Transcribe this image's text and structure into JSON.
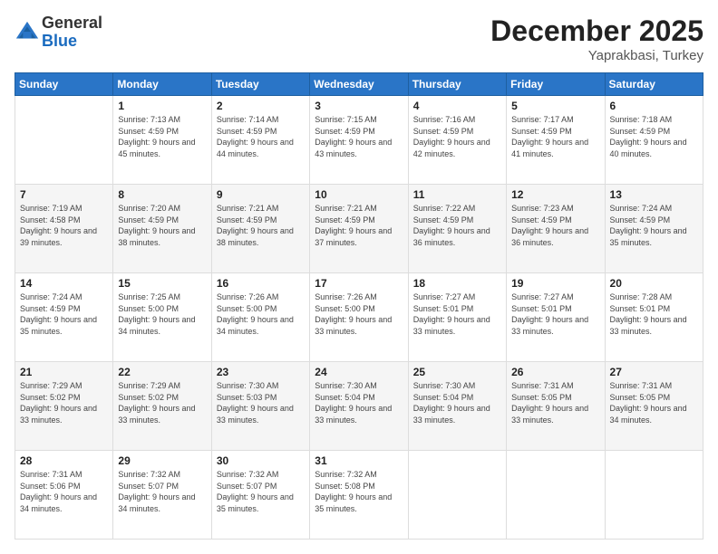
{
  "logo": {
    "general": "General",
    "blue": "Blue"
  },
  "header": {
    "month": "December 2025",
    "location": "Yaprakbasi, Turkey"
  },
  "weekdays": [
    "Sunday",
    "Monday",
    "Tuesday",
    "Wednesday",
    "Thursday",
    "Friday",
    "Saturday"
  ],
  "weeks": [
    [
      {
        "day": "",
        "sunrise": "",
        "sunset": "",
        "daylight": ""
      },
      {
        "day": "1",
        "sunrise": "7:13 AM",
        "sunset": "4:59 PM",
        "daylight": "9 hours and 45 minutes."
      },
      {
        "day": "2",
        "sunrise": "7:14 AM",
        "sunset": "4:59 PM",
        "daylight": "9 hours and 44 minutes."
      },
      {
        "day": "3",
        "sunrise": "7:15 AM",
        "sunset": "4:59 PM",
        "daylight": "9 hours and 43 minutes."
      },
      {
        "day": "4",
        "sunrise": "7:16 AM",
        "sunset": "4:59 PM",
        "daylight": "9 hours and 42 minutes."
      },
      {
        "day": "5",
        "sunrise": "7:17 AM",
        "sunset": "4:59 PM",
        "daylight": "9 hours and 41 minutes."
      },
      {
        "day": "6",
        "sunrise": "7:18 AM",
        "sunset": "4:59 PM",
        "daylight": "9 hours and 40 minutes."
      }
    ],
    [
      {
        "day": "7",
        "sunrise": "7:19 AM",
        "sunset": "4:58 PM",
        "daylight": "9 hours and 39 minutes."
      },
      {
        "day": "8",
        "sunrise": "7:20 AM",
        "sunset": "4:59 PM",
        "daylight": "9 hours and 38 minutes."
      },
      {
        "day": "9",
        "sunrise": "7:21 AM",
        "sunset": "4:59 PM",
        "daylight": "9 hours and 38 minutes."
      },
      {
        "day": "10",
        "sunrise": "7:21 AM",
        "sunset": "4:59 PM",
        "daylight": "9 hours and 37 minutes."
      },
      {
        "day": "11",
        "sunrise": "7:22 AM",
        "sunset": "4:59 PM",
        "daylight": "9 hours and 36 minutes."
      },
      {
        "day": "12",
        "sunrise": "7:23 AM",
        "sunset": "4:59 PM",
        "daylight": "9 hours and 36 minutes."
      },
      {
        "day": "13",
        "sunrise": "7:24 AM",
        "sunset": "4:59 PM",
        "daylight": "9 hours and 35 minutes."
      }
    ],
    [
      {
        "day": "14",
        "sunrise": "7:24 AM",
        "sunset": "4:59 PM",
        "daylight": "9 hours and 35 minutes."
      },
      {
        "day": "15",
        "sunrise": "7:25 AM",
        "sunset": "5:00 PM",
        "daylight": "9 hours and 34 minutes."
      },
      {
        "day": "16",
        "sunrise": "7:26 AM",
        "sunset": "5:00 PM",
        "daylight": "9 hours and 34 minutes."
      },
      {
        "day": "17",
        "sunrise": "7:26 AM",
        "sunset": "5:00 PM",
        "daylight": "9 hours and 33 minutes."
      },
      {
        "day": "18",
        "sunrise": "7:27 AM",
        "sunset": "5:01 PM",
        "daylight": "9 hours and 33 minutes."
      },
      {
        "day": "19",
        "sunrise": "7:27 AM",
        "sunset": "5:01 PM",
        "daylight": "9 hours and 33 minutes."
      },
      {
        "day": "20",
        "sunrise": "7:28 AM",
        "sunset": "5:01 PM",
        "daylight": "9 hours and 33 minutes."
      }
    ],
    [
      {
        "day": "21",
        "sunrise": "7:29 AM",
        "sunset": "5:02 PM",
        "daylight": "9 hours and 33 minutes."
      },
      {
        "day": "22",
        "sunrise": "7:29 AM",
        "sunset": "5:02 PM",
        "daylight": "9 hours and 33 minutes."
      },
      {
        "day": "23",
        "sunrise": "7:30 AM",
        "sunset": "5:03 PM",
        "daylight": "9 hours and 33 minutes."
      },
      {
        "day": "24",
        "sunrise": "7:30 AM",
        "sunset": "5:04 PM",
        "daylight": "9 hours and 33 minutes."
      },
      {
        "day": "25",
        "sunrise": "7:30 AM",
        "sunset": "5:04 PM",
        "daylight": "9 hours and 33 minutes."
      },
      {
        "day": "26",
        "sunrise": "7:31 AM",
        "sunset": "5:05 PM",
        "daylight": "9 hours and 33 minutes."
      },
      {
        "day": "27",
        "sunrise": "7:31 AM",
        "sunset": "5:05 PM",
        "daylight": "9 hours and 34 minutes."
      }
    ],
    [
      {
        "day": "28",
        "sunrise": "7:31 AM",
        "sunset": "5:06 PM",
        "daylight": "9 hours and 34 minutes."
      },
      {
        "day": "29",
        "sunrise": "7:32 AM",
        "sunset": "5:07 PM",
        "daylight": "9 hours and 34 minutes."
      },
      {
        "day": "30",
        "sunrise": "7:32 AM",
        "sunset": "5:07 PM",
        "daylight": "9 hours and 35 minutes."
      },
      {
        "day": "31",
        "sunrise": "7:32 AM",
        "sunset": "5:08 PM",
        "daylight": "9 hours and 35 minutes."
      },
      {
        "day": "",
        "sunrise": "",
        "sunset": "",
        "daylight": ""
      },
      {
        "day": "",
        "sunrise": "",
        "sunset": "",
        "daylight": ""
      },
      {
        "day": "",
        "sunrise": "",
        "sunset": "",
        "daylight": ""
      }
    ]
  ]
}
